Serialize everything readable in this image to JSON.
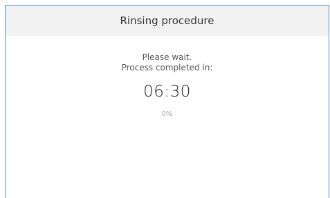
{
  "dialog": {
    "title": "Rinsing procedure"
  },
  "status": {
    "line1": "Please wait.",
    "line2": "Process completed in:",
    "countdown": "06:30",
    "progress_text": "0%",
    "progress_value": 0
  }
}
